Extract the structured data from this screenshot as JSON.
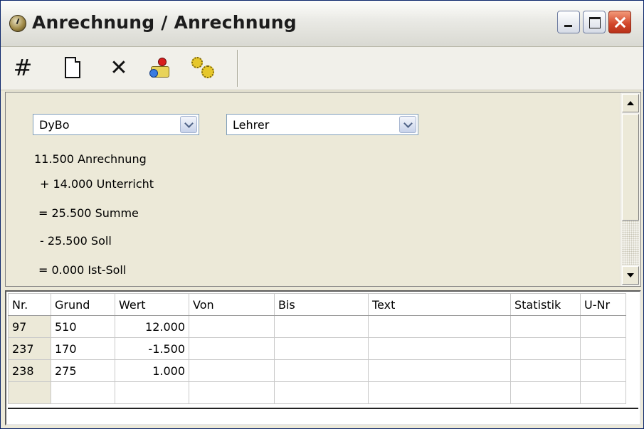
{
  "window": {
    "title": "Anrechnung / Anrechnung"
  },
  "toolbar": {
    "buttons": [
      "grid-icon",
      "new-document-icon",
      "delete-icon",
      "pin-icon",
      "gears-icon"
    ]
  },
  "filters": {
    "teacher": "DyBo",
    "category": "Lehrer"
  },
  "summary": [
    "11.500 Anrechnung",
    "+ 14.000 Unterricht",
    "= 25.500 Summe",
    "- 25.500 Soll",
    "= 0.000 Ist-Soll"
  ],
  "table": {
    "columns": [
      "Nr.",
      "Grund",
      "Wert",
      "Von",
      "Bis",
      "Text",
      "Statistik",
      "U-Nr"
    ],
    "rows": [
      {
        "nr": "97",
        "grund": "510",
        "wert": "12.000",
        "von": "",
        "bis": "",
        "text": "",
        "statistik": "",
        "unr": ""
      },
      {
        "nr": "237",
        "grund": "170",
        "wert": "-1.500",
        "von": "",
        "bis": "",
        "text": "",
        "statistik": "",
        "unr": ""
      },
      {
        "nr": "238",
        "grund": "275",
        "wert": "1.000",
        "von": "",
        "bis": "",
        "text": "",
        "statistik": "",
        "unr": ""
      }
    ]
  }
}
